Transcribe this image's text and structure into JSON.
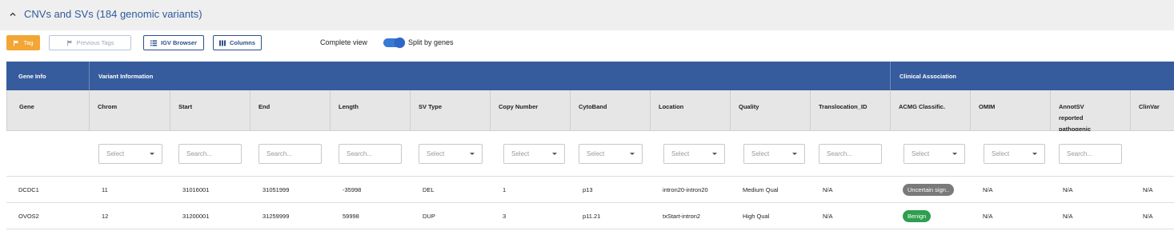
{
  "section": {
    "title": "CNVs and SVs (184 genomic variants)"
  },
  "toolbar": {
    "tag_label": "Tag",
    "previous_tags_label": "Previous Tags",
    "igv_label": "IGV Browser",
    "columns_label": "Columns",
    "complete_view_label": "Complete view",
    "split_by_genes_label": "Split by genes",
    "split_by_genes_on": true
  },
  "table": {
    "groups": [
      {
        "label": "Gene Info"
      },
      {
        "label": "Variant Information"
      },
      {
        "label": "Clinical Association"
      }
    ],
    "columns": [
      {
        "label": "Gene"
      },
      {
        "label": "Chrom"
      },
      {
        "label": "Start"
      },
      {
        "label": "End"
      },
      {
        "label": "Length"
      },
      {
        "label": "SV Type"
      },
      {
        "label": "Copy Number"
      },
      {
        "label": "CytoBand"
      },
      {
        "label": "Location"
      },
      {
        "label": "Quality"
      },
      {
        "label": "Translocation_ID"
      },
      {
        "label": "ACMG Classific."
      },
      {
        "label": "OMIM"
      },
      {
        "label": "AnnotSV reported pathogenic"
      },
      {
        "label": "ClinVar"
      }
    ],
    "filters": [
      {
        "text": ""
      },
      {
        "text": "Select",
        "type": "select"
      },
      {
        "text": "Search...",
        "type": "search"
      },
      {
        "text": "Search...",
        "type": "search"
      },
      {
        "text": "Search...",
        "type": "search"
      },
      {
        "text": "Select",
        "type": "select"
      },
      {
        "text": "Select",
        "type": "select"
      },
      {
        "text": "Select",
        "type": "select"
      },
      {
        "text": "Select",
        "type": "select"
      },
      {
        "text": "Select",
        "type": "select"
      },
      {
        "text": "Search...",
        "type": "search"
      },
      {
        "text": "Select",
        "type": "select"
      },
      {
        "text": "Select",
        "type": "select"
      },
      {
        "text": "Search...",
        "type": "search"
      }
    ],
    "rows": [
      {
        "cells": [
          "DCDC1",
          "11",
          "31016001",
          "31051999",
          "-35998",
          "DEL",
          "1",
          "p13",
          "intron20-intron20",
          "Medium Qual",
          "N/A",
          "Uncertain sign..",
          "N/A",
          "N/A",
          "N/A"
        ],
        "acmg_color": "#7a7a7a"
      },
      {
        "cells": [
          "OVOS2",
          "12",
          "31200001",
          "31259999",
          "59998",
          "DUP",
          "3",
          "p11.21",
          "txStart-intron2",
          "High Qual",
          "N/A",
          "Benign",
          "N/A",
          "N/A",
          "N/A"
        ],
        "acmg_color": "#2e9e4f"
      }
    ]
  },
  "colors": {
    "header_blue": "#375c9d",
    "tag_orange": "#f3a633",
    "toggle_blue": "#3a78d8"
  }
}
